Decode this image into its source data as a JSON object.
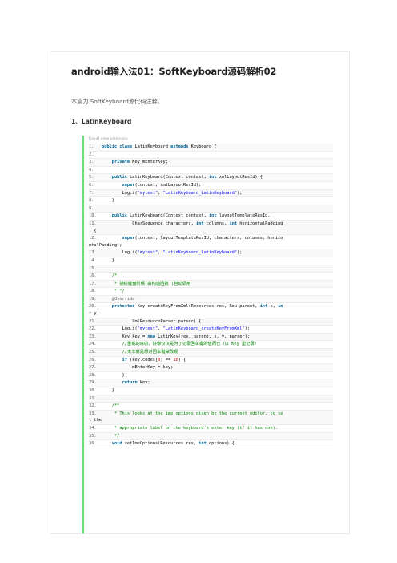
{
  "title": "android输入法01：SoftKeyboard源码解析02",
  "intro": "本篇为 SoftKeyboard源代码注释。",
  "section_heading": "1、LatinKeyboard",
  "code_toolbar": "[java] view plaincopy",
  "code_lines": [
    {
      "n": "1.",
      "html": "<span class=\"kw\">public class</span> LatinKeyboard <span class=\"kw\">extends</span> Keyboard {"
    },
    {
      "n": "2.",
      "html": ""
    },
    {
      "n": "3.",
      "html": "    <span class=\"kw\">private</span> Key mEnterKey;"
    },
    {
      "n": "4.",
      "html": ""
    },
    {
      "n": "5.",
      "html": "    <span class=\"kw\">public</span> LatinKeyboard(Context context, <span class=\"kw\">int</span> xmlLayoutResId) {"
    },
    {
      "n": "6.",
      "html": "        <span class=\"kw\">super</span>(context, xmlLayoutResId);"
    },
    {
      "n": "7.",
      "html": "        Log.i(<span class=\"str\">\"mytest\"</span>, <span class=\"str\">\"LatinKeyboard_LatinKeyboard\"</span>);"
    },
    {
      "n": "8.",
      "html": "    }"
    },
    {
      "n": "9.",
      "html": ""
    },
    {
      "n": "10.",
      "html": "    <span class=\"kw\">public</span> LatinKeyboard(Context context, <span class=\"kw\">int</span> layoutTemplateResId,"
    },
    {
      "n": "11.",
      "html": "            CharSequence characters, <span class=\"kw\">int</span> columns, <span class=\"kw\">int</span> horizontalPadding",
      "cont": ") {"
    },
    {
      "n": "12.",
      "html": "        <span class=\"kw\">super</span>(context, layoutTemplateResId, characters, columns, horizo",
      "cont": "ntalPadding);"
    },
    {
      "n": "13.",
      "html": "        Log.i(<span class=\"str\">\"mytest\"</span>, <span class=\"str\">\"LatinKeyboard_LatinKeyboard\"</span>);"
    },
    {
      "n": "14.",
      "html": "    }"
    },
    {
      "n": "15.",
      "html": ""
    },
    {
      "n": "16.",
      "html": "    <span class=\"cm\">/*</span>"
    },
    {
      "n": "17.",
      "html": "<span class=\"cm\">     * 描绘键盘时候(由构造函数 )自动调用</span>"
    },
    {
      "n": "18.",
      "html": "<span class=\"cm\">     * */</span>"
    },
    {
      "n": "19.",
      "html": "    <span class=\"an\">@Override</span>"
    },
    {
      "n": "20.",
      "html": "    <span class=\"kw\">protected</span> Key createKeyFromXml(Resources res, Row parent, <span class=\"kw\">int</span> x, <span class=\"kw\">in</span>",
      "cont": "t y,"
    },
    {
      "n": "21.",
      "html": "            XmlResourceParser parser) {"
    },
    {
      "n": "22.",
      "html": "        Log.i(<span class=\"str\">\"mytest\"</span>, <span class=\"str\">\"LatinKeyboard_createKeyFromXml\"</span>);"
    },
    {
      "n": "23.",
      "html": "        Key key = <span class=\"kw\">new</span> LatinKey(res, parent, x, y, parser);"
    },
    {
      "n": "24.",
      "html": "        <span class=\"cm\">//重载的目的，好像仅仅是为了记录回车键的值而已（以 Key 型记录）</span>"
    },
    {
      "n": "25.",
      "html": "        <span class=\"cm\">//无非就是想对回车键做改观</span>"
    },
    {
      "n": "26.",
      "html": "        <span class=\"kw\">if</span> (key.codes[<span class=\"cn\">0</span>] == <span class=\"cn\">10</span>) {"
    },
    {
      "n": "27.",
      "html": "            mEnterKey = key;"
    },
    {
      "n": "28.",
      "html": "        }"
    },
    {
      "n": "29.",
      "html": "        <span class=\"kw\">return</span> key;"
    },
    {
      "n": "30.",
      "html": "    }"
    },
    {
      "n": "31.",
      "html": ""
    },
    {
      "n": "32.",
      "html": "    <span class=\"cm\">/**</span>"
    },
    {
      "n": "33.",
      "html": "<span class=\"cm\">     * This looks at the ime options given by the current editor, to se</span>",
      "cont": "t the"
    },
    {
      "n": "34.",
      "html": "<span class=\"cm\">     * appropriate label on the keyboard's enter key (if it has one).</span>"
    },
    {
      "n": "35.",
      "html": "<span class=\"cm\">     */</span>"
    },
    {
      "n": "36.",
      "html": "    <span class=\"kw\">void</span> setImeOptions(Resources res, <span class=\"kw\">int</span> options) {"
    }
  ]
}
